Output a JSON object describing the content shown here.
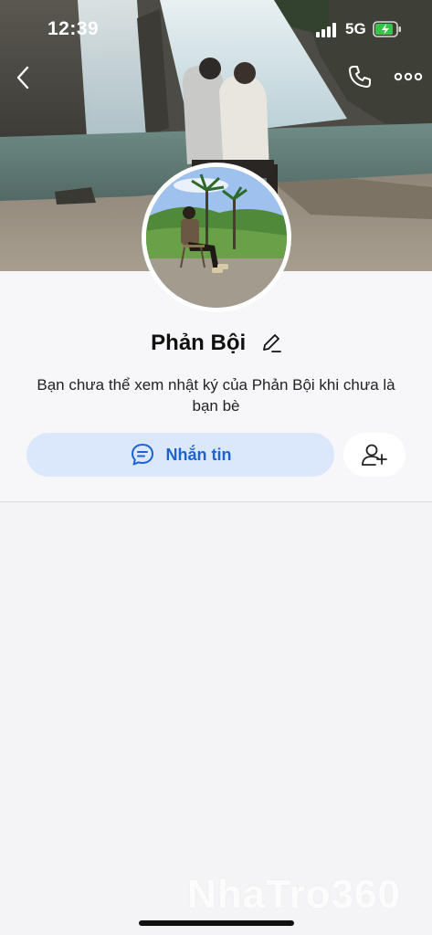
{
  "status_bar": {
    "time": "12:39",
    "network": "5G",
    "battery_charging": true
  },
  "nav": {
    "back_icon": "chevron-left-icon",
    "call_icon": "phone-icon",
    "more_icon": "more-horizontal-icon"
  },
  "profile": {
    "name": "Phản Bội",
    "notice": "Bạn chưa thể xem nhật ký của Phản Bội khi chưa là bạn bè"
  },
  "actions": {
    "message_label": "Nhắn tin",
    "message_icon": "chat-bubble-icon",
    "add_friend_icon": "add-user-icon"
  },
  "watermark": "NhaTro360",
  "colors": {
    "accent": "#1d63d0",
    "message_button_bg": "#dbe8fb",
    "background": "#f4f4f6"
  }
}
